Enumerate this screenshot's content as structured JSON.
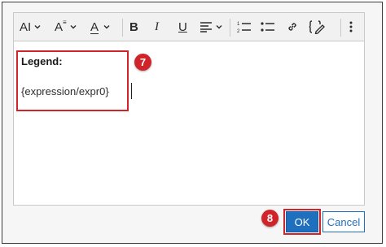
{
  "toolbar": {
    "buttons": [
      {
        "icon": "font-family-icon",
        "label": "AI",
        "has_dropdown": true
      },
      {
        "icon": "font-size-icon",
        "label": "A",
        "has_dropdown": true
      },
      {
        "icon": "font-color-icon",
        "label": "A",
        "has_dropdown": true
      },
      {
        "icon": "bold-icon",
        "label": "B"
      },
      {
        "icon": "italic-icon",
        "label": "I"
      },
      {
        "icon": "underline-icon",
        "label": "U"
      },
      {
        "icon": "align-icon",
        "has_dropdown": true
      },
      {
        "icon": "numbered-list-icon"
      },
      {
        "icon": "bulleted-list-icon"
      },
      {
        "icon": "link-icon"
      },
      {
        "icon": "insert-expression-icon"
      },
      {
        "icon": "more-options-icon"
      }
    ]
  },
  "editor": {
    "legend_label": "Legend:",
    "expression_text": "{expression/expr0}"
  },
  "callouts": {
    "step7": "7",
    "step8": "8"
  },
  "buttons": {
    "ok_label": "OK",
    "cancel_label": "Cancel"
  },
  "colors": {
    "accent_blue": "#1f6fbf",
    "callout_red": "#d0242b"
  }
}
